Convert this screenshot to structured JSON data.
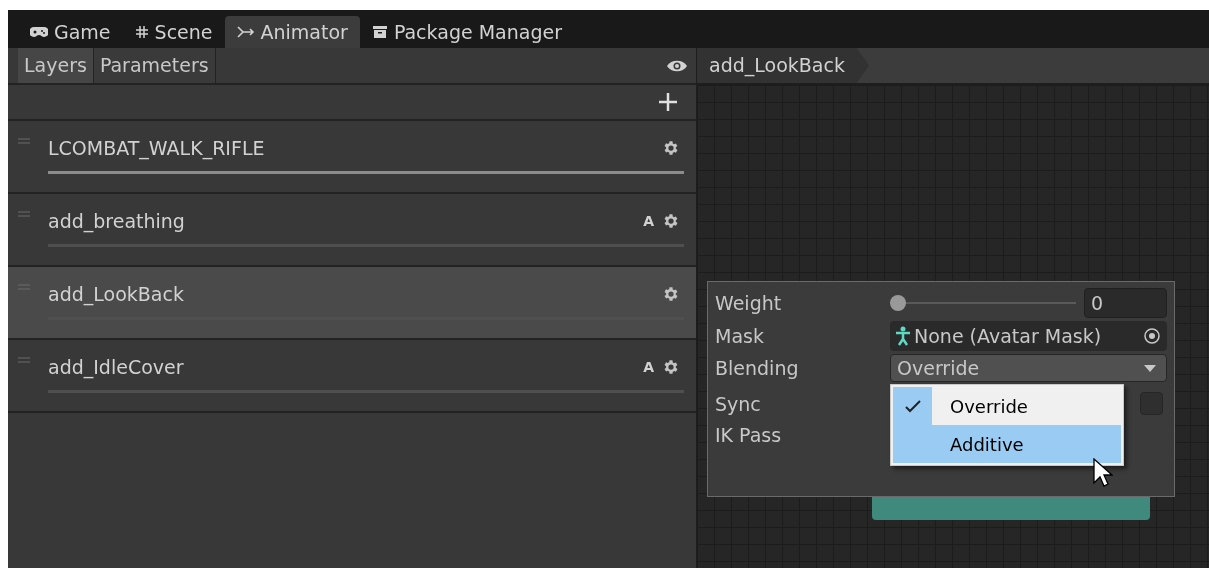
{
  "tabs": [
    {
      "label": "Game",
      "selected": false
    },
    {
      "label": "Scene",
      "selected": false
    },
    {
      "label": "Animator",
      "selected": true
    },
    {
      "label": "Package Manager",
      "selected": false
    }
  ],
  "sub_tabs": [
    {
      "label": "Layers",
      "selected": true
    },
    {
      "label": "Parameters",
      "selected": false
    }
  ],
  "breadcrumb": "add_LookBack",
  "layers": [
    {
      "name": "LCOMBAT_WALK_RIFLE",
      "dimmed": false,
      "selected": false
    },
    {
      "name": "add_breathing",
      "dimmed": true,
      "additive_badge": "A",
      "selected": false
    },
    {
      "name": "add_LookBack",
      "dimmed": true,
      "selected": true
    },
    {
      "name": "add_IdleCover",
      "dimmed": true,
      "additive_badge": "A",
      "selected": false
    }
  ],
  "layer_settings": {
    "weight": {
      "label": "Weight",
      "level": 0,
      "value": "0"
    },
    "mask": {
      "label": "Mask",
      "value": "None (Avatar Mask)"
    },
    "blending": {
      "label": "Blending",
      "value": "Override"
    },
    "sync": {
      "label": "Sync",
      "checked": false
    },
    "ik_pass": {
      "label": "IK Pass"
    },
    "menu": [
      {
        "label": "Override",
        "checked": true,
        "selected": false
      },
      {
        "label": "Additive",
        "checked": false,
        "selected": true
      }
    ]
  }
}
